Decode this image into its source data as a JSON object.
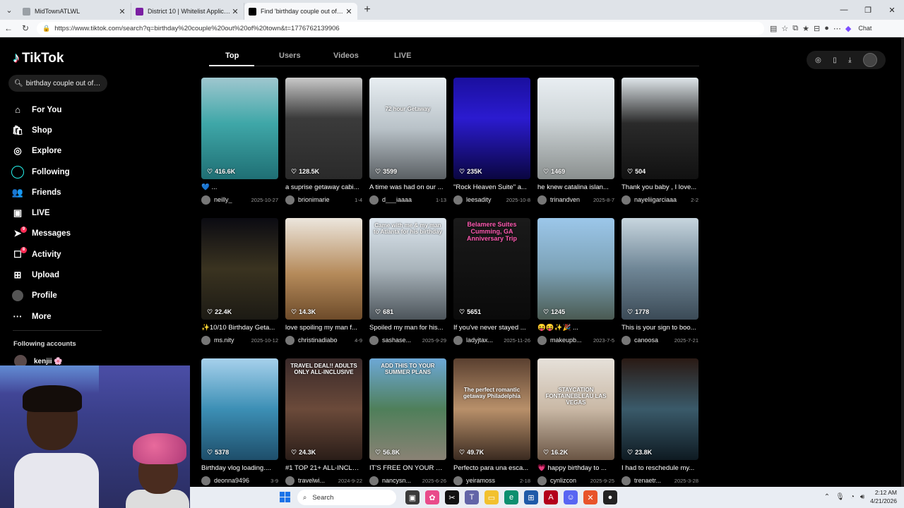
{
  "browser": {
    "tabs": [
      {
        "title": "MidTownATLWL",
        "color": "#9aa0a6",
        "active": false
      },
      {
        "title": "District 10 | Whitelist Application",
        "color": "#7b1fa2",
        "active": false
      },
      {
        "title": "Find 'birthday couple out of town'",
        "color": "#000000",
        "active": true
      }
    ],
    "url": "https://www.tiktok.com/search?q=birthday%20couple%20out%20of%20town&t=1776762139906",
    "chat_label": "Chat"
  },
  "sidebar": {
    "logo": "TikTok",
    "search_value": "birthday couple out of t...",
    "items": [
      {
        "label": "For You",
        "icon": "home-icon",
        "glyph": "⌂"
      },
      {
        "label": "Shop",
        "icon": "shop-icon",
        "glyph": "🛍"
      },
      {
        "label": "Explore",
        "icon": "compass-icon",
        "glyph": "◎"
      },
      {
        "label": "Following",
        "icon": "following-icon",
        "glyph": ""
      },
      {
        "label": "Friends",
        "icon": "friends-icon",
        "glyph": "👥"
      },
      {
        "label": "LIVE",
        "icon": "live-icon",
        "glyph": "▣"
      },
      {
        "label": "Messages",
        "icon": "messages-icon",
        "glyph": "➤",
        "badge": "9"
      },
      {
        "label": "Activity",
        "icon": "activity-icon",
        "glyph": "☐",
        "badge": "8"
      },
      {
        "label": "Upload",
        "icon": "upload-icon",
        "glyph": "⊞"
      },
      {
        "label": "Profile",
        "icon": "profile-icon",
        "glyph": ""
      },
      {
        "label": "More",
        "icon": "more-icon",
        "glyph": "···"
      }
    ],
    "following_title": "Following accounts",
    "following_accounts": [
      {
        "name": "kenjii 🌸"
      }
    ]
  },
  "search_tabs": [
    "Top",
    "Users",
    "Videos",
    "LIVE"
  ],
  "videos": [
    {
      "likes": "416.6K",
      "desc": "💙 ...",
      "user": "neilly_",
      "date": "2025-10-27",
      "bg": "linear-gradient(180deg,#9fc7cf 0%,#3fa7a8 45%,#1f6f74 100%)",
      "overlay": ""
    },
    {
      "likes": "128.5K",
      "desc": "a suprise getaway cabi...",
      "user": "brionimarie",
      "date": "1-4",
      "bg": "linear-gradient(180deg,#c9c9c9 0%,#3b3b3b 40%,#2a2a2a 100%)",
      "overlay": ""
    },
    {
      "likes": "3599",
      "desc": "A time was had on our ...",
      "user": "d___iaaaa",
      "date": "1-13",
      "bg": "linear-gradient(180deg,#e8eef2 0%,#b9c2c8 50%,#5a5f63 100%)",
      "overlay": "72 hour Getaway"
    },
    {
      "likes": "235K",
      "desc": "\"Rock Heaven Suite\" a...",
      "user": "leesadity",
      "date": "2025-10-8",
      "bg": "linear-gradient(180deg,#1a0f9e 0%,#2b1bd0 40%,#0a0640 100%)",
      "overlay": ""
    },
    {
      "likes": "1469",
      "desc": "he knew catalina islan...",
      "user": "trinandven",
      "date": "2025-8-7",
      "bg": "linear-gradient(180deg,#e9eef2 0%,#cfd6d9 40%,#8a8f8e 100%)",
      "overlay": ""
    },
    {
      "likes": "504",
      "desc": "Thank you baby , I love...",
      "user": "nayeliigarciaaa",
      "date": "2-2",
      "bg": "linear-gradient(180deg,#dfe6ea 0%,#2a2a2a 45%,#111 100%)",
      "overlay": ""
    },
    {
      "likes": "22.4K",
      "desc": "✨10/10 Birthday Geta...",
      "user": "ms.nity",
      "date": "2025-10-12",
      "bg": "linear-gradient(180deg,#0b0b12 0%,#3a3320 50%,#1c1a14 100%)",
      "overlay": ""
    },
    {
      "likes": "14.3K",
      "desc": "love spoiling my man f...",
      "user": "christinadiabo",
      "date": "4-9",
      "bg": "linear-gradient(180deg,#ece6dd 0%,#b58a5a 55%,#6d4b2a 100%)",
      "overlay": ""
    },
    {
      "likes": "681",
      "desc": "Spoiled my man for his...",
      "user": "sashase...",
      "date": "2025-9-29",
      "bg": "linear-gradient(180deg,#dde6ee 0%,#a9b4bb 50%,#4c545a 100%)",
      "overlay": "Came with me & my man to Atlanta for his birthday"
    },
    {
      "likes": "5651",
      "desc": "If you've never stayed ...",
      "user": "ladyjtax...",
      "date": "2025-11-26",
      "bg": "linear-gradient(180deg,#1a1a1a 0%,#0a0a0a 100%)",
      "overlay": "Belamere Suites Cumming, GA Anniversary Trip"
    },
    {
      "likes": "1245",
      "desc": "😝😝✨🎉 ...",
      "user": "makeupb...",
      "date": "2023-7-5",
      "bg": "linear-gradient(180deg,#9cc7ea 0%,#7da3b8 50%,#4a5a52 100%)",
      "overlay": ""
    },
    {
      "likes": "1778",
      "desc": "This is your sign to boo...",
      "user": "canoosa",
      "date": "2025-7-21",
      "bg": "linear-gradient(180deg,#c8d6df 0%,#6f8696 50%,#3b4a56 100%)",
      "overlay": ""
    },
    {
      "likes": "5378",
      "desc": "Birthday vlog loading....",
      "user": "deonna9496",
      "date": "3-9",
      "bg": "linear-gradient(180deg,#a7d1ec 0%,#3c8fb5 50%,#1e4e6a 100%)",
      "overlay": ""
    },
    {
      "likes": "24.3K",
      "desc": "#1 TOP 21+ ALL-INCLU...",
      "user": "travelwi...",
      "date": "2024-9-22",
      "bg": "linear-gradient(180deg,#3a2a2a 0%,#6b4a3a 50%,#2a1d18 100%)",
      "overlay": "TRAVEL DEAL!! ADULTS ONLY ALL-INCLUSIVE"
    },
    {
      "likes": "56.8K",
      "desc": "IT'S FREE ON YOUR BI...",
      "user": "nancysn...",
      "date": "2025-6-26",
      "bg": "linear-gradient(180deg,#6da8d6 0%,#4f7f5a 50%,#8a8275 100%)",
      "overlay": "ADD THIS TO YOUR SUMMER PLANS"
    },
    {
      "likes": "49.7K",
      "desc": "Perfecto para una esca...",
      "user": "yeiramoss",
      "date": "2-18",
      "bg": "linear-gradient(180deg,#5a4030 0%,#b8906a 50%,#3a2a20 100%)",
      "overlay": "The perfect romantic getaway Philadelphia"
    },
    {
      "likes": "16.2K",
      "desc": "💗 happy birthday to ...",
      "user": "cynlizcon",
      "date": "2025-9-25",
      "bg": "linear-gradient(180deg,#e6e1da 0%,#c9b8a5 50%,#6a5544 100%)",
      "overlay": "STAYCATION FONTAINEBLEAU LAS VEGAS"
    },
    {
      "likes": "23.8K",
      "desc": "I had to reschedule my...",
      "user": "trenaetr...",
      "date": "2025-3-28",
      "bg": "linear-gradient(180deg,#2a1a14 0%,#3a5a6a 50%,#0e1a22 100%)",
      "overlay": ""
    }
  ],
  "taskbar": {
    "search_label": "Search",
    "time": "2:12 AM",
    "date": "4/21/2026"
  }
}
